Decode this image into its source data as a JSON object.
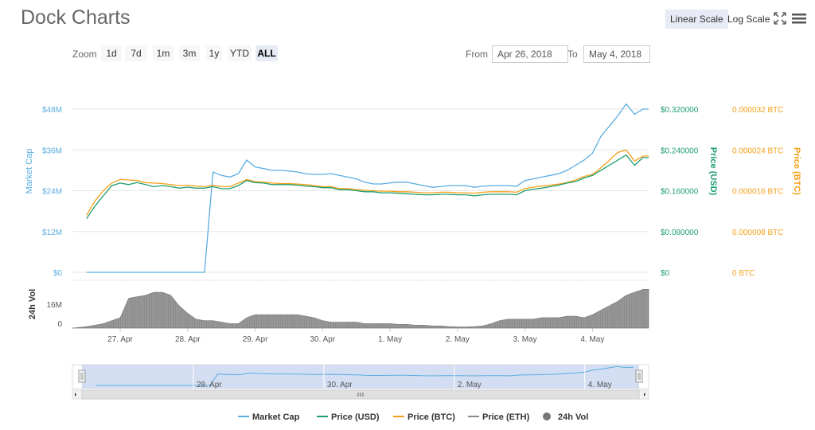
{
  "title": "Dock Charts",
  "toolbar": {
    "linear_scale": "Linear Scale",
    "log_scale": "Log Scale",
    "expand_icon": "expand-icon",
    "menu_icon": "hamburger-menu-icon"
  },
  "zoom": {
    "label": "Zoom",
    "buttons": [
      "1d",
      "7d",
      "1m",
      "3m",
      "1y",
      "YTD",
      "ALL"
    ],
    "active": "ALL"
  },
  "range": {
    "from_label": "From",
    "from_value": "Apr 26, 2018",
    "to_label": "To",
    "to_value": "May 4, 2018"
  },
  "colors": {
    "market_cap": "#5aade0",
    "price_usd": "#1e9e6e",
    "price_btc": "#f5a11b",
    "price_eth": "#888888",
    "volume": "#777777"
  },
  "chart_data": {
    "type": "line",
    "x_dates": [
      "2018-04-26T12:00",
      "2018-04-26T15:00",
      "2018-04-26T18:00",
      "2018-04-26T21:00",
      "2018-04-27T00:00",
      "2018-04-27T03:00",
      "2018-04-27T06:00",
      "2018-04-27T09:00",
      "2018-04-27T12:00",
      "2018-04-27T15:00",
      "2018-04-27T18:00",
      "2018-04-27T21:00",
      "2018-04-28T00:00",
      "2018-04-28T03:00",
      "2018-04-28T06:00",
      "2018-04-28T09:00",
      "2018-04-28T12:00",
      "2018-04-28T15:00",
      "2018-04-28T18:00",
      "2018-04-28T21:00",
      "2018-04-29T00:00",
      "2018-04-29T03:00",
      "2018-04-29T06:00",
      "2018-04-29T09:00",
      "2018-04-29T12:00",
      "2018-04-29T15:00",
      "2018-04-29T18:00",
      "2018-04-29T21:00",
      "2018-04-30T00:00",
      "2018-04-30T03:00",
      "2018-04-30T06:00",
      "2018-04-30T09:00",
      "2018-04-30T12:00",
      "2018-04-30T15:00",
      "2018-04-30T18:00",
      "2018-04-30T21:00",
      "2018-05-01T00:00",
      "2018-05-01T03:00",
      "2018-05-01T06:00",
      "2018-05-01T09:00",
      "2018-05-01T12:00",
      "2018-05-01T15:00",
      "2018-05-01T18:00",
      "2018-05-01T21:00",
      "2018-05-02T00:00",
      "2018-05-02T03:00",
      "2018-05-02T06:00",
      "2018-05-02T09:00",
      "2018-05-02T12:00",
      "2018-05-02T15:00",
      "2018-05-02T18:00",
      "2018-05-02T21:00",
      "2018-05-03T00:00",
      "2018-05-03T03:00",
      "2018-05-03T06:00",
      "2018-05-03T09:00",
      "2018-05-03T12:00",
      "2018-05-03T15:00",
      "2018-05-03T18:00",
      "2018-05-03T21:00",
      "2018-05-04T00:00",
      "2018-05-04T03:00",
      "2018-05-04T06:00",
      "2018-05-04T09:00",
      "2018-05-04T12:00",
      "2018-05-04T15:00",
      "2018-05-04T18:00"
    ],
    "series": [
      {
        "name": "Market Cap",
        "axis": "left",
        "values": [
          0,
          0,
          0,
          0,
          0,
          0,
          0,
          0,
          0,
          0,
          0,
          0,
          0,
          0,
          0,
          29.5,
          28.5,
          28,
          29,
          33,
          31,
          30.5,
          30,
          30,
          29.8,
          29.5,
          29,
          28.8,
          28.8,
          29,
          28.5,
          28,
          27.5,
          26.5,
          26,
          26,
          26.3,
          26.5,
          26.5,
          26,
          25.5,
          25,
          25.2,
          25.5,
          25.5,
          25.5,
          25,
          25.3,
          25.5,
          25.5,
          25.5,
          25.3,
          27,
          27.5,
          28,
          28.5,
          29,
          30,
          31.5,
          33,
          35,
          40,
          43,
          46,
          49.5,
          46.5,
          48
        ]
      },
      {
        "name": "Price (USD)",
        "axis": "usd",
        "values": [
          0.105,
          0.13,
          0.15,
          0.17,
          0.175,
          0.172,
          0.176,
          0.172,
          0.168,
          0.17,
          0.168,
          0.165,
          0.167,
          0.165,
          0.165,
          0.168,
          0.164,
          0.164,
          0.17,
          0.18,
          0.176,
          0.175,
          0.172,
          0.172,
          0.172,
          0.171,
          0.169,
          0.168,
          0.166,
          0.166,
          0.162,
          0.162,
          0.16,
          0.158,
          0.158,
          0.156,
          0.156,
          0.155,
          0.154,
          0.153,
          0.152,
          0.152,
          0.153,
          0.153,
          0.152,
          0.152,
          0.15,
          0.152,
          0.153,
          0.153,
          0.153,
          0.152,
          0.16,
          0.163,
          0.165,
          0.168,
          0.171,
          0.175,
          0.178,
          0.185,
          0.19,
          0.2,
          0.21,
          0.22,
          0.23,
          0.21,
          0.225
        ]
      },
      {
        "name": "Price (BTC)",
        "axis": "btc",
        "values": [
          1.12e-05,
          1.4e-05,
          1.6e-05,
          1.75e-05,
          1.82e-05,
          1.81e-05,
          1.8e-05,
          1.76e-05,
          1.75e-05,
          1.74e-05,
          1.72e-05,
          1.7e-05,
          1.71e-05,
          1.69e-05,
          1.68e-05,
          1.71e-05,
          1.68e-05,
          1.68e-05,
          1.75e-05,
          1.82e-05,
          1.78e-05,
          1.77e-05,
          1.75e-05,
          1.74e-05,
          1.74e-05,
          1.73e-05,
          1.72e-05,
          1.7e-05,
          1.68e-05,
          1.68e-05,
          1.64e-05,
          1.64e-05,
          1.62e-05,
          1.61e-05,
          1.6e-05,
          1.59e-05,
          1.59e-05,
          1.58e-05,
          1.58e-05,
          1.57e-05,
          1.56e-05,
          1.56e-05,
          1.57e-05,
          1.57e-05,
          1.56e-05,
          1.56e-05,
          1.55e-05,
          1.57e-05,
          1.58e-05,
          1.58e-05,
          1.58e-05,
          1.57e-05,
          1.64e-05,
          1.67e-05,
          1.69e-05,
          1.71e-05,
          1.73e-05,
          1.76e-05,
          1.81e-05,
          1.88e-05,
          1.92e-05,
          2.05e-05,
          2.2e-05,
          2.35e-05,
          2.4e-05,
          2.18e-05,
          2.28e-05
        ]
      },
      {
        "name": "Price (ETH)",
        "axis": "none",
        "values": []
      },
      {
        "name": "24h Vol",
        "axis": "volume",
        "values": [
          1,
          2,
          3,
          5,
          7,
          20,
          21,
          22,
          24,
          24,
          22,
          15,
          10,
          6,
          5,
          5,
          4,
          3,
          3,
          7,
          9,
          9,
          9,
          9,
          9,
          9,
          8,
          7,
          5,
          4,
          4,
          4,
          4,
          3,
          3,
          3,
          3,
          2.5,
          2.5,
          2,
          2,
          1.5,
          1.5,
          1,
          0.8,
          0.8,
          1,
          1.5,
          3,
          5,
          6,
          6,
          6,
          6,
          7,
          7,
          7,
          8,
          8,
          7,
          9,
          12,
          15,
          18,
          22,
          24,
          26
        ]
      }
    ],
    "left_axis": {
      "title": "Market Cap",
      "ticks": [
        "$0",
        "$12M",
        "$24M",
        "$36M",
        "$48M"
      ],
      "range": [
        0,
        48
      ],
      "unit": "$M"
    },
    "usd_axis": {
      "title": "Price (USD)",
      "ticks": [
        "$0",
        "$0.080000",
        "$0.160000",
        "$0.240000",
        "$0.320000"
      ],
      "range": [
        0,
        0.32
      ]
    },
    "btc_axis": {
      "title": "Price (BTC)",
      "ticks": [
        "0 BTC",
        "0.000008 BTC",
        "0.000016 BTC",
        "0.000024 BTC",
        "0.000032 BTC"
      ],
      "range": [
        0,
        3.2e-05
      ]
    },
    "volume_axis": {
      "title": "24h Vol",
      "ticks": [
        "0",
        "16M"
      ],
      "range": [
        0,
        32
      ],
      "unit": "M"
    },
    "x_ticks": [
      "27. Apr",
      "28. Apr",
      "29. Apr",
      "30. Apr",
      "1. May",
      "2. May",
      "3. May",
      "4. May"
    ],
    "navigator_ticks": [
      "28. Apr",
      "30. Apr",
      "2. May",
      "4. May"
    ],
    "legend": [
      "Market Cap",
      "Price (USD)",
      "Price (BTC)",
      "Price (ETH)",
      "24h Vol"
    ],
    "grid": true
  }
}
